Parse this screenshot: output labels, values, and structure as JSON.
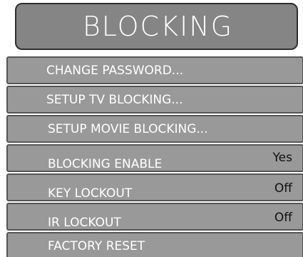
{
  "header": {
    "title": "BLOCKING"
  },
  "menu": {
    "items": [
      {
        "label": "CHANGE PASSWORD...",
        "value": ""
      },
      {
        "label": "SETUP TV BLOCKING...",
        "value": ""
      },
      {
        "label": "SETUP MOVIE BLOCKING...",
        "value": ""
      },
      {
        "label": "BLOCKING ENABLE",
        "value": "Yes"
      },
      {
        "label": "KEY LOCKOUT",
        "value": "Off"
      },
      {
        "label": "IR LOCKOUT",
        "value": "Off"
      },
      {
        "label": "FACTORY RESET",
        "value": ""
      }
    ]
  },
  "colors": {
    "title_bg": "#858585",
    "item_bg": "#999999",
    "border": "#555555",
    "label_text": "#ffffff",
    "value_text": "#111111"
  }
}
